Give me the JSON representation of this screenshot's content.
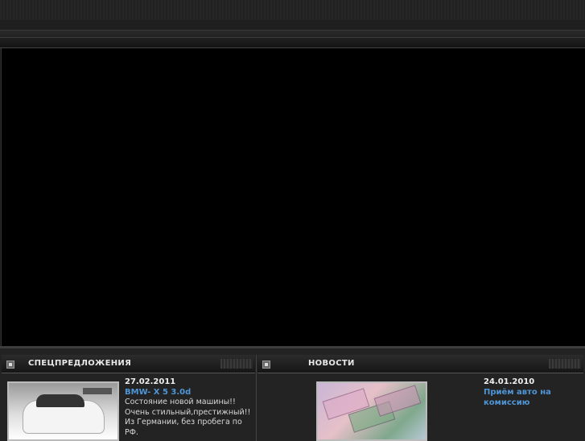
{
  "specials": {
    "title": "СПЕЦПРЕДЛОЖЕНИЯ",
    "date": "27.02.2011",
    "link": "BMW- X 5 3.0d",
    "description": "Состояние новой машины!! Очень стильный,престижный!! Из Германии, без пробега по РФ."
  },
  "news": {
    "title": "НОВОСТИ",
    "date": "24.01.2010",
    "link": "Приём авто на комиссию"
  },
  "colors": {
    "link": "#4f95d6",
    "background": "#1b1b1b"
  },
  "icons": [
    "panel-bullet-icon"
  ]
}
